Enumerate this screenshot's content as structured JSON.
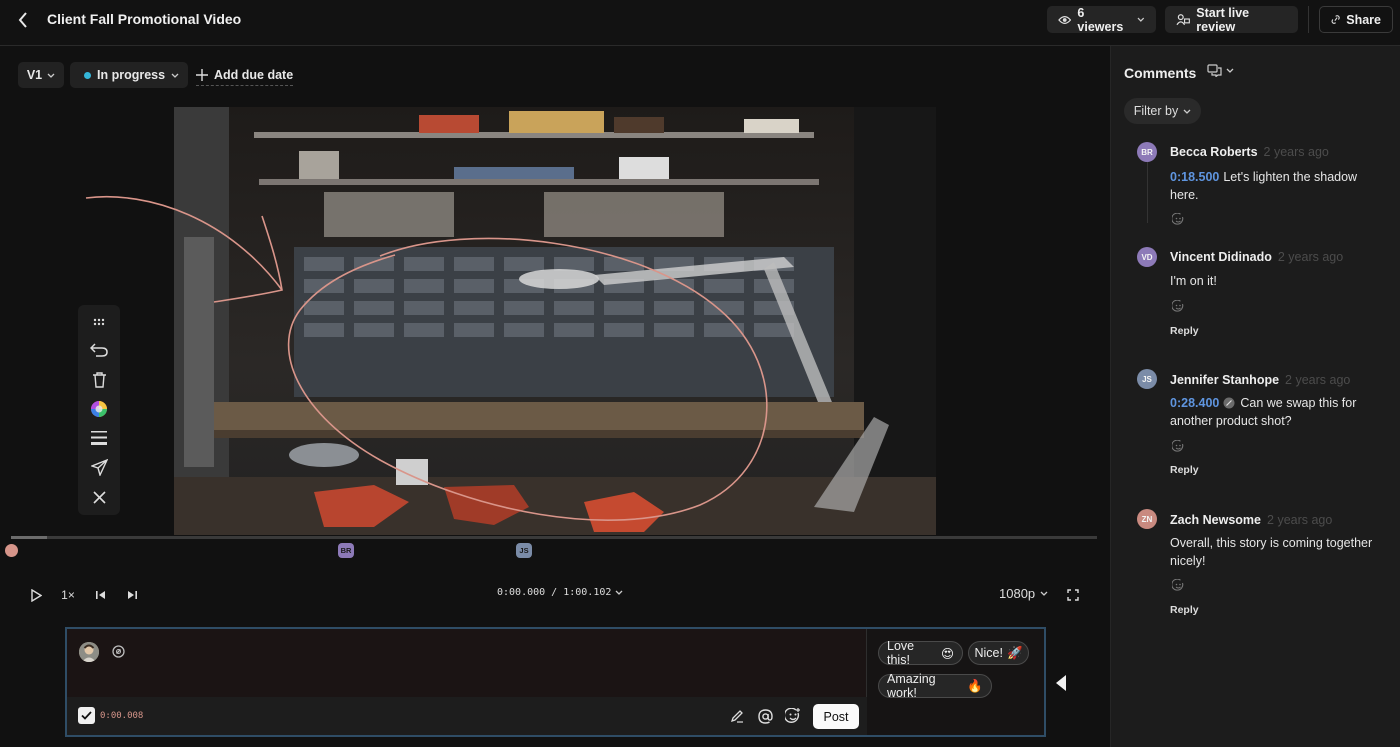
{
  "header": {
    "title": "Client Fall Promotional Video",
    "viewers_label": "6 viewers",
    "live_review_label": "Start live review",
    "share_label": "Share"
  },
  "toolbar": {
    "version_label": "V1",
    "status_label": "In progress",
    "status_color": "#34b6d9",
    "due_date_label": "Add due date"
  },
  "player": {
    "speed_label": "1×",
    "timecode": "0:00.000 / 1:00.102",
    "quality_label": "1080p",
    "markers": [
      {
        "initials": "BR",
        "color": "#8d7ab8"
      },
      {
        "initials": "JS",
        "color": "#7b8ca8"
      }
    ]
  },
  "draw_tools": {
    "icons": [
      "grip-icon",
      "undo-icon",
      "trash-icon",
      "color-picker-icon",
      "stroke-width-icon",
      "send-icon",
      "close-icon"
    ]
  },
  "annotation": {
    "color": "#d9958a"
  },
  "composer": {
    "placeholder": "",
    "timestamp": "0:00.008",
    "post_label": "Post",
    "quick_replies": [
      {
        "label": "Love this!",
        "emoji": "😍"
      },
      {
        "label": "Nice!",
        "emoji": "🚀"
      },
      {
        "label": "Amazing work!",
        "emoji": "🔥"
      }
    ]
  },
  "comments_panel": {
    "title": "Comments",
    "filter_label": "Filter by",
    "reply_label": "Reply",
    "comments": [
      {
        "initials": "BR",
        "avatar_color": "#8d7ab8",
        "name": "Becca Roberts",
        "time": "2 years ago",
        "timestamp": "0:18.500",
        "text": "Let's lighten the shadow here."
      },
      {
        "initials": "VD",
        "avatar_color": "#8d7ab8",
        "name": "Vincent Didinado",
        "time": "2 years ago",
        "timestamp": "",
        "text": "I'm on it!"
      },
      {
        "initials": "JS",
        "avatar_color": "#7b8ca8",
        "name": "Jennifer Stanhope",
        "time": "2 years ago",
        "timestamp": "0:28.400",
        "text": "Can we swap this for another product shot?"
      },
      {
        "initials": "ZN",
        "avatar_color": "#c98a80",
        "name": "Zach Newsome",
        "time": "2 years ago",
        "timestamp": "",
        "text": "Overall, this story is coming together nicely!"
      }
    ]
  }
}
